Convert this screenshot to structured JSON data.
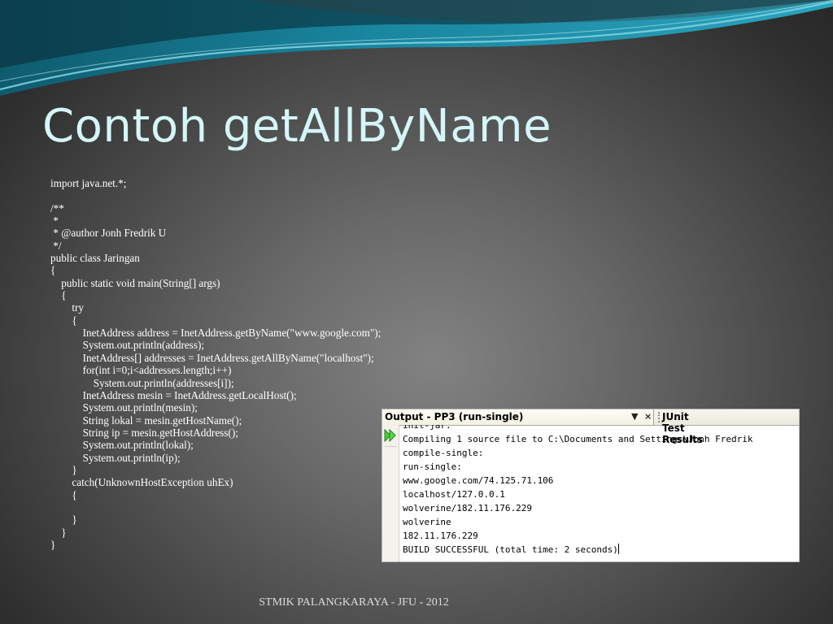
{
  "slide": {
    "title": "Contoh getAllByName",
    "footer": "STMIK PALANGKARAYA - JFU - 2012",
    "code": "import java.net.*;\n\n/**\n *\n * @author Jonh Fredrik U\n */\npublic class Jaringan\n{\n    public static void main(String[] args)\n    {\n        try\n        {\n            InetAddress address = InetAddress.getByName(\"www.google.com\");\n            System.out.println(address);\n            InetAddress[] addresses = InetAddress.getAllByName(\"localhost\");\n            for(int i=0;i<addresses.length;i++)\n                System.out.println(addresses[i]);\n            InetAddress mesin = InetAddress.getLocalHost();\n            System.out.println(mesin);\n            String lokal = mesin.getHostName();\n            String ip = mesin.getHostAddress();\n            System.out.println(lokal);\n            System.out.println(ip);\n        }\n        catch(UnknownHostException uhEx)\n        {\n\n        }\n    }\n}"
  },
  "ide": {
    "output_tab_title": "Output - PP3 (run-single)",
    "minimize_glyph": "▼",
    "close_glyph": "×",
    "junit_tab_title": "JUnit Test Results",
    "run_icon": "rerun-icon",
    "console_text": "init-jar:\nCompiling 1 source file to C:\\Documents and Settings\\Jonh Fredrik\ncompile-single:\nrun-single:\nwww.google.com/74.125.71.106\nlocalhost/127.0.0.1\nwolverine/182.11.176.229\nwolverine\n182.11.176.229\nBUILD SUCCESSFUL (total time: 2 seconds)"
  },
  "colors": {
    "title": "#d5f6f8",
    "wave_teal": "#1c8aa3",
    "wave_light": "#6fc3d4"
  }
}
